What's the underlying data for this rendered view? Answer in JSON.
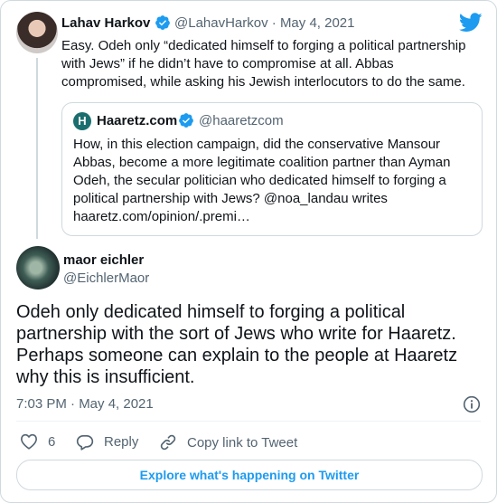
{
  "parent_tweet": {
    "name": "Lahav Harkov",
    "handle_date": "@LahavHarkov · May 4, 2021",
    "text": "Easy. Odeh only “dedicated himself to forging a political partnership with Jews” if he didn’t have to compromise at all. Abbas compromised, while asking his Jewish interlocutors to do the same.",
    "verified_icon": "verified-badge-icon"
  },
  "quoted_tweet": {
    "name": "Haaretz.com",
    "handle": "@haaretzcom",
    "avatar_letter": "H",
    "text": "How, in this election campaign, did the conservative Mansour Abbas, become a more legitimate coalition partner than Ayman Odeh, the secular politician who dedicated himself to forging a political partnership with Jews? @noa_landau writes haaretz.com/opinion/.premi…"
  },
  "main_tweet": {
    "name": "maor eichler",
    "handle": "@EichlerMaor",
    "text": "Odeh only dedicated himself to forging a political partnership with the sort of Jews who write for Haaretz. Perhaps someone can explain to the people at Haaretz why this is insufficient.",
    "timestamp": "7:03 PM · May 4, 2021"
  },
  "actions": {
    "like_count": "6",
    "reply_label": "Reply",
    "copy_link_label": "Copy link to Tweet"
  },
  "explore_label": "Explore what's happening on Twitter",
  "colors": {
    "twitter_blue": "#1d9bf0",
    "text_primary": "#0f1419",
    "text_secondary": "#536471",
    "border": "#cfd9de"
  }
}
